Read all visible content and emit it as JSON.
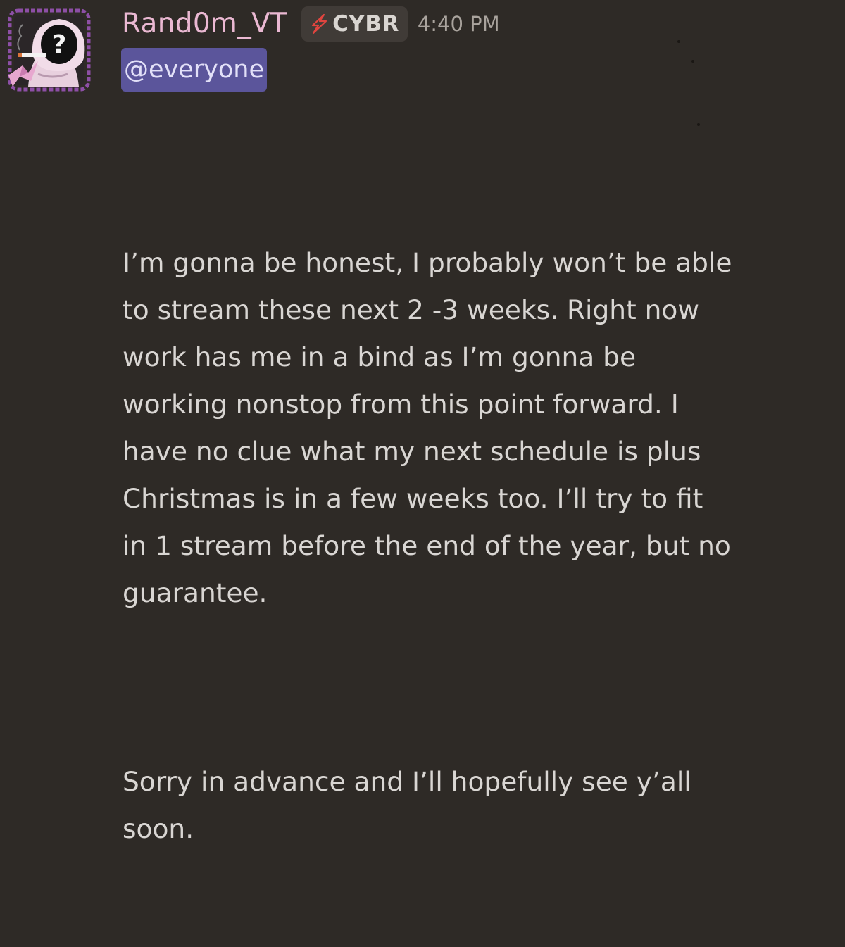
{
  "message": {
    "author": {
      "username": "Rand0m_VT",
      "avatar_icon": "question-mark-avatar-icon",
      "username_color": "#eab8d2"
    },
    "guild_tag": {
      "icon": "lightning-bolt-icon",
      "text": "CYBR"
    },
    "timestamp": "4:40 PM",
    "mention": "@everyone",
    "paragraphs": [
      "I’m gonna be honest, I probably won’t be able\nto stream these next 2 -3 weeks. Right now\nwork has me in a bind as I’m gonna be\nworking nonstop from this point forward. I\nhave no clue what my next schedule is plus\nChristmas is in a few weeks too. I’ll try to fit\nin 1 stream before the end of the year, but no\nguarantee.",
      "Sorry in advance and I’ll hopefully see y’all\nsoon."
    ]
  },
  "colors": {
    "background": "#2e2a26",
    "mention_bg": "#5b559b",
    "tag_bg": "#403b37"
  }
}
